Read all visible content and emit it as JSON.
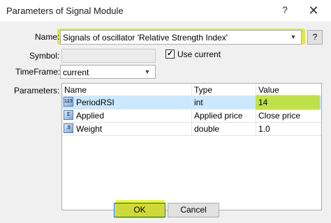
{
  "window": {
    "title": "Parameters of Signal Module",
    "help_glyph": "?",
    "close_glyph": "✕"
  },
  "name_field": {
    "label": "Name:",
    "value": "Signals of oscillator 'Relative Strength Index'",
    "help_label": "?"
  },
  "symbol_field": {
    "label": "Symbol:",
    "value": "",
    "use_current_label": "Use current",
    "use_current_checked": true
  },
  "timeframe_field": {
    "label": "TimeFrame:",
    "value": "current"
  },
  "parameters": {
    "label": "Parameters:",
    "columns": [
      "Name",
      "Type",
      "Value"
    ],
    "rows": [
      {
        "name": "PeriodRSI",
        "type": "int",
        "value": "14"
      },
      {
        "name": "Applied",
        "type": "Applied price",
        "value": "Close price"
      },
      {
        "name": "Weight",
        "type": "double",
        "value": "1.0"
      }
    ],
    "row_icon": "parameter-icon"
  },
  "buttons": {
    "ok": "OK",
    "cancel": "Cancel"
  },
  "colors": {
    "highlight": "#e9f72a",
    "selection": "#cce8ff",
    "dialog_bg": "#f0f0f0",
    "default_button_border": "#0078d7"
  }
}
